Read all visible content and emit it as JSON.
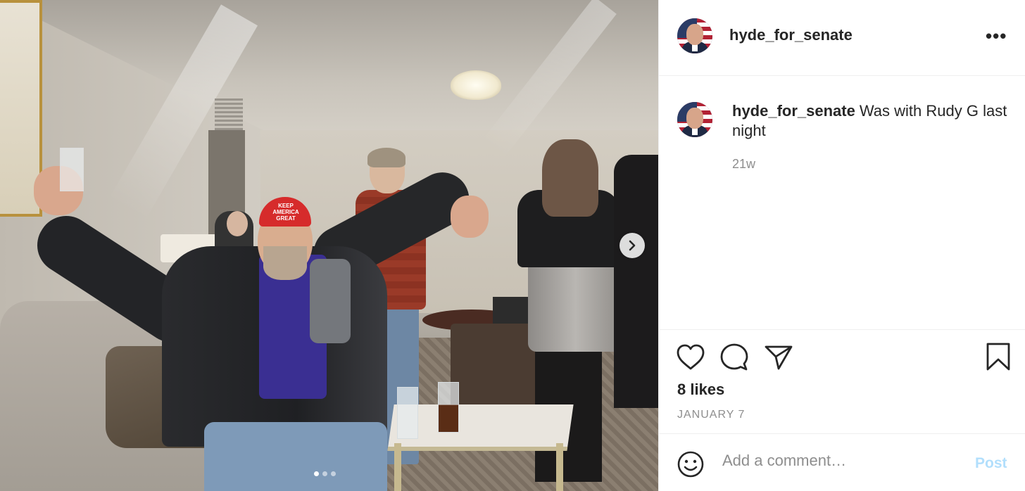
{
  "post": {
    "username": "hyde_for_senate",
    "more_label": "•••",
    "caption_user": "hyde_for_senate",
    "caption_text": "Was with Rudy G last night",
    "age": "21w",
    "likes": "8 likes",
    "date": "JANUARY 7"
  },
  "photo": {
    "hat_text": "KEEP AMERICA GREAT",
    "carousel": {
      "dots": 3,
      "active_index": 0
    }
  },
  "comment": {
    "placeholder": "Add a comment…",
    "post_label": "Post"
  },
  "icons": [
    "like-icon",
    "comment-icon",
    "share-icon",
    "bookmark-icon",
    "emoji-icon",
    "chevron-right-icon",
    "more-icon"
  ],
  "colors": {
    "post_disabled": "#b2dffc",
    "text": "#262626",
    "muted": "#8e8e8e"
  }
}
